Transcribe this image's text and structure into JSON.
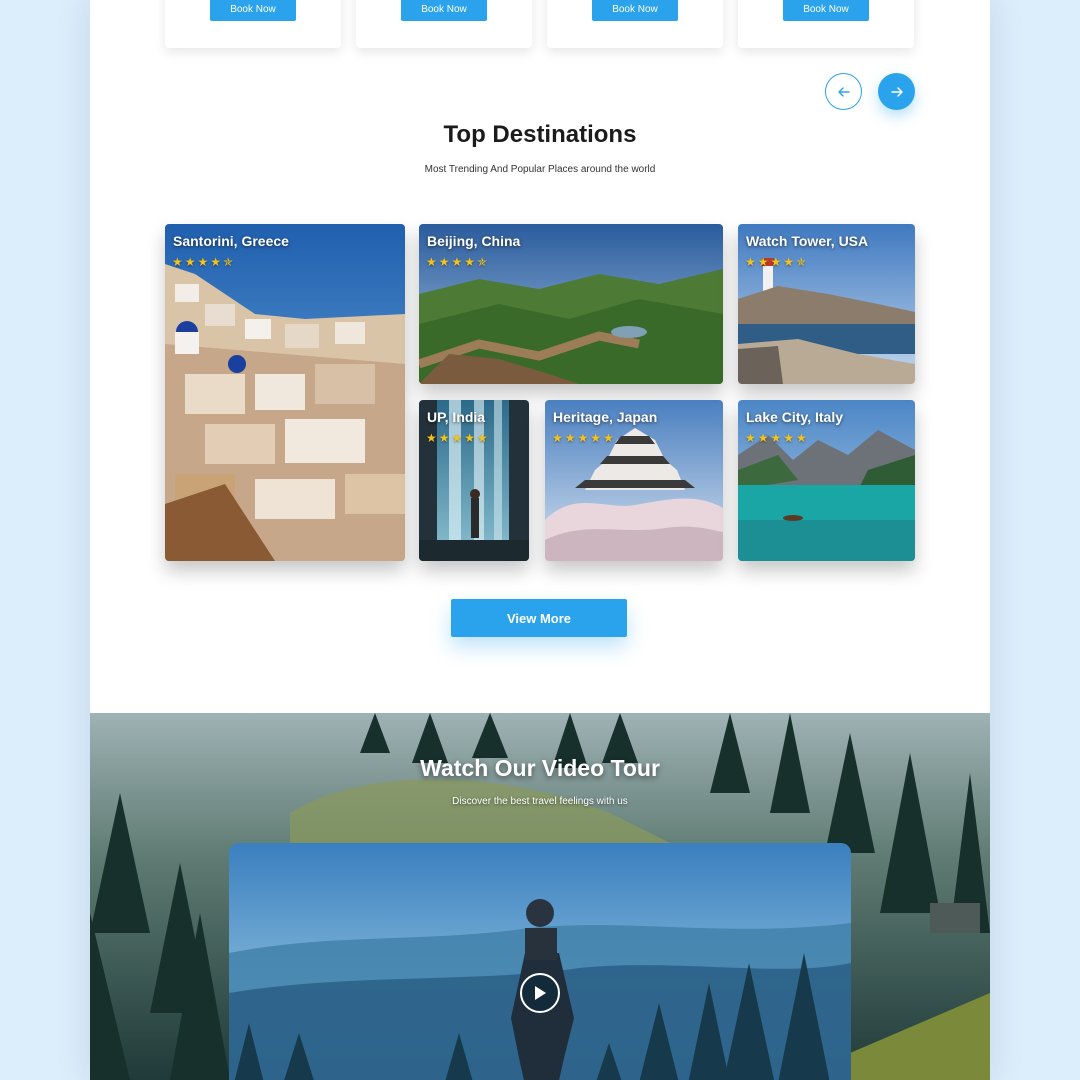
{
  "packages": {
    "book_label": "Book Now",
    "cards": [
      {
        "book_label": "Book Now"
      },
      {
        "book_label": "Book Now"
      },
      {
        "book_label": "Book Now"
      },
      {
        "book_label": "Book Now"
      }
    ]
  },
  "carousel": {
    "prev_icon": "arrow-left-icon",
    "next_icon": "arrow-right-icon"
  },
  "destinations": {
    "title": "Top Destinations",
    "subtitle": "Most Trending And Popular Places around the world",
    "items": [
      {
        "name": "Santorini, Greece",
        "stars": "★★★★✯"
      },
      {
        "name": "Beijing, China",
        "stars": "★★★★✯"
      },
      {
        "name": "Watch Tower, USA",
        "stars": "★★★★✯"
      },
      {
        "name": "UP, India",
        "stars": "★★★★★"
      },
      {
        "name": "Heritage, Japan",
        "stars": "★★★★★"
      },
      {
        "name": "Lake City, Italy",
        "stars": "★★★★★"
      }
    ],
    "view_more_label": "View More"
  },
  "video": {
    "title": "Watch Our Video Tour",
    "subtitle": "Discover the best travel feelings with us",
    "play_icon": "play-icon"
  },
  "colors": {
    "accent": "#2aa3ec",
    "star": "#f5c21b",
    "background": "#dcedfb"
  }
}
